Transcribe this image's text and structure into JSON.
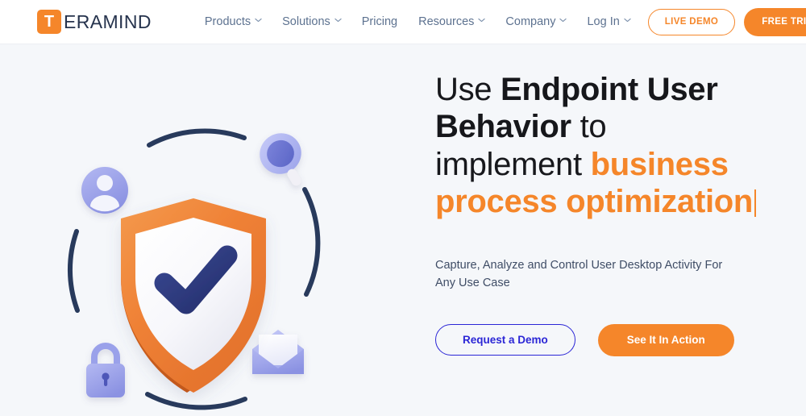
{
  "brand": {
    "mark_letter": "T",
    "word": "ERAMIND"
  },
  "nav": {
    "items": [
      {
        "label": "Products",
        "has_dropdown": true
      },
      {
        "label": "Solutions",
        "has_dropdown": true
      },
      {
        "label": "Pricing",
        "has_dropdown": false
      },
      {
        "label": "Resources",
        "has_dropdown": true
      },
      {
        "label": "Company",
        "has_dropdown": true
      },
      {
        "label": "Log In",
        "has_dropdown": true
      }
    ],
    "live_demo_label": "LIVE DEMO",
    "free_trial_label": "FREE TRIAL"
  },
  "hero": {
    "headline": {
      "part1": "Use ",
      "bold1": "Endpoint User Behavior",
      "part2": " to implement ",
      "accent": "business process optimization"
    },
    "subhead_line1": "Capture, Analyze and Control User Desktop Activity",
    "subhead_line2": "For Any Use Case",
    "primary_button": "See It In Action",
    "secondary_button": "Request a Demo"
  },
  "illustration": {
    "alt": "3D orange security shield with navy checkmark encircled by floating user, search, lock and mail icons",
    "icons": [
      "user-avatar-icon",
      "magnifier-icon",
      "padlock-icon",
      "envelope-icon",
      "shield-check-icon"
    ]
  },
  "colors": {
    "brand_orange": "#F5862A",
    "navy": "#26334D",
    "nav_link": "#5d7290",
    "hero_bg": "#f5f7fa",
    "demo_blue": "#2B26D6",
    "periwinkle": "#9DA3E8",
    "check_navy": "#2C3E7E"
  }
}
